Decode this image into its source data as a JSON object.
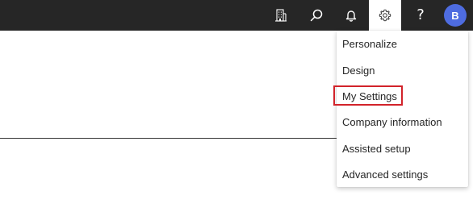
{
  "topbar": {
    "buttons": [
      {
        "name": "company-icon"
      },
      {
        "name": "search-icon"
      },
      {
        "name": "bell-icon"
      },
      {
        "name": "gear-icon",
        "active": true
      },
      {
        "name": "help-icon",
        "glyph": "?"
      }
    ],
    "avatar": {
      "initial": "B",
      "color": "#4e6ce0"
    },
    "background": "#262626"
  },
  "settings_menu": {
    "items": [
      {
        "label": "Personalize"
      },
      {
        "label": "Design"
      },
      {
        "label": "My Settings",
        "highlighted": true
      },
      {
        "label": "Company information"
      },
      {
        "label": "Assisted setup"
      },
      {
        "label": "Advanced settings"
      }
    ],
    "highlight_color": "#d2232a"
  }
}
